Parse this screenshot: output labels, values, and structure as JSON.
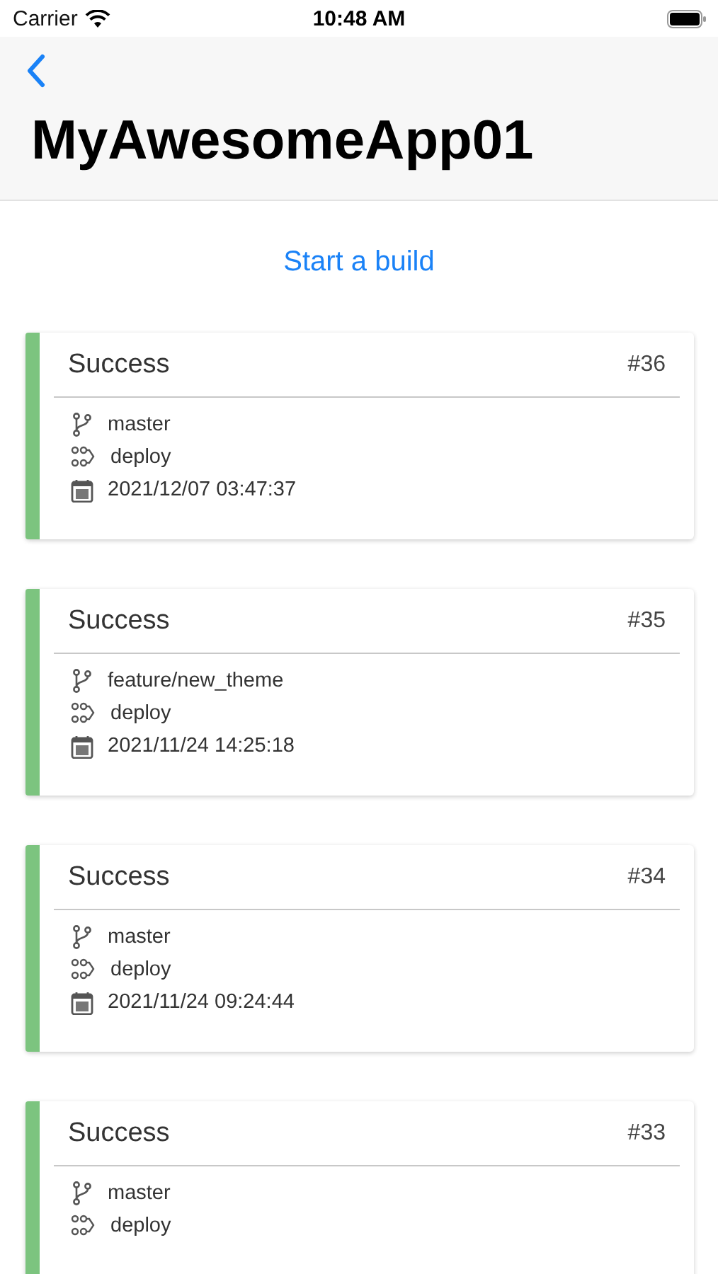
{
  "status_bar": {
    "carrier": "Carrier",
    "time": "10:48 AM"
  },
  "nav": {
    "title": "MyAwesomeApp01"
  },
  "start_button": "Start a build",
  "builds": [
    {
      "color": "#7cc47f",
      "label": "Success",
      "number": "#36",
      "branch": "master",
      "workflow": "deploy",
      "date": "2021/12/07 03:47:37"
    },
    {
      "color": "#7cc47f",
      "label": "Success",
      "number": "#35",
      "branch": "feature/new_theme",
      "workflow": "deploy",
      "date": "2021/11/24 14:25:18"
    },
    {
      "color": "#7cc47f",
      "label": "Success",
      "number": "#34",
      "branch": "master",
      "workflow": "deploy",
      "date": "2021/11/24 09:24:44"
    },
    {
      "color": "#7cc47f",
      "label": "Success",
      "number": "#33",
      "branch": "master",
      "workflow": "deploy"
    }
  ]
}
